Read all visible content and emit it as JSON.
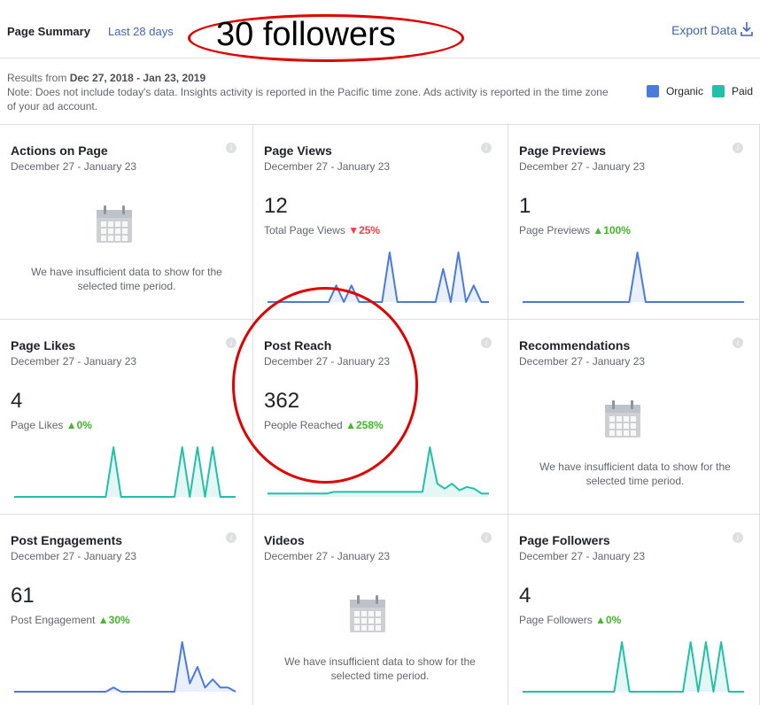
{
  "header": {
    "title": "Page Summary",
    "period": "Last 28 days",
    "export_label": "Export Data",
    "export_icon": "download-icon"
  },
  "annotation": {
    "followers_text": "30 followers"
  },
  "note": {
    "results_prefix": "Results from ",
    "results_range": "Dec 27, 2018 - Jan 23, 2019",
    "text": "Note: Does not include today's data. Insights activity is reported in the Pacific time zone. Ads activity is reported in the time zone of your ad account."
  },
  "legend": {
    "organic_label": "Organic",
    "paid_label": "Paid",
    "organic_color": "#4a7bdb",
    "paid_color": "#20c1a8"
  },
  "cards": [
    {
      "title": "Actions on Page",
      "dates": "December 27 - January 23",
      "empty": "We have insufficient data to show for the selected time period."
    },
    {
      "title": "Page Views",
      "dates": "December 27 - January 23",
      "value": "12",
      "sub_label": "Total Page Views",
      "delta": "25%",
      "direction": "down",
      "series": [
        0,
        0,
        0,
        0,
        0,
        0,
        0,
        0,
        0,
        1,
        0,
        1,
        0,
        0,
        0,
        0,
        3,
        0,
        0,
        0,
        0,
        0,
        0,
        2,
        0,
        3,
        0,
        1,
        0,
        0
      ]
    },
    {
      "title": "Page Previews",
      "dates": "December 27 - January 23",
      "value": "1",
      "sub_label": "Page Previews",
      "delta": "100%",
      "direction": "up",
      "series": [
        0,
        0,
        0,
        0,
        0,
        0,
        0,
        0,
        0,
        0,
        0,
        0,
        0,
        0,
        1,
        0,
        0,
        0,
        0,
        0,
        0,
        0,
        0,
        0,
        0,
        0,
        0,
        0
      ]
    },
    {
      "title": "Page Likes",
      "dates": "December 27 - January 23",
      "value": "4",
      "sub_label": "Page Likes",
      "delta": "0%",
      "direction": "up",
      "series": [
        0,
        0,
        0,
        0,
        0,
        0,
        0,
        0,
        0,
        0,
        0,
        0,
        0,
        1,
        0,
        0,
        0,
        0,
        0,
        0,
        0,
        0,
        1,
        0,
        1,
        0,
        1,
        0,
        0,
        0
      ]
    },
    {
      "title": "Post Reach",
      "dates": "December 27 - January 23",
      "value": "362",
      "sub_label": "People Reached",
      "delta": "258%",
      "direction": "up",
      "series": [
        2,
        2,
        2,
        2,
        2,
        2,
        2,
        2,
        2,
        3,
        3,
        3,
        3,
        3,
        3,
        3,
        3,
        3,
        3,
        3,
        3,
        3,
        30,
        8,
        5,
        8,
        4,
        6,
        5,
        2,
        2
      ]
    },
    {
      "title": "Recommendations",
      "dates": "December 27 - January 23",
      "empty": "We have insufficient data to show for the selected time period."
    },
    {
      "title": "Post Engagements",
      "dates": "December 27 - January 23",
      "value": "61",
      "sub_label": "Post Engagement",
      "delta": "30%",
      "direction": "up",
      "series": [
        0,
        0,
        0,
        0,
        0,
        0,
        0,
        0,
        0,
        0,
        0,
        0,
        0,
        1,
        0,
        0,
        0,
        0,
        0,
        0,
        0,
        0,
        12,
        2,
        6,
        1,
        3,
        1,
        1,
        0
      ]
    },
    {
      "title": "Videos",
      "dates": "December 27 - January 23",
      "empty": "We have insufficient data to show for the selected time period."
    },
    {
      "title": "Page Followers",
      "dates": "December 27 - January 23",
      "value": "4",
      "sub_label": "Page Followers",
      "delta": "0%",
      "direction": "up",
      "series": [
        0,
        0,
        0,
        0,
        0,
        0,
        0,
        0,
        0,
        0,
        0,
        0,
        0,
        1,
        0,
        0,
        0,
        0,
        0,
        0,
        0,
        0,
        1,
        0,
        1,
        0,
        1,
        0,
        0,
        0
      ]
    }
  ]
}
